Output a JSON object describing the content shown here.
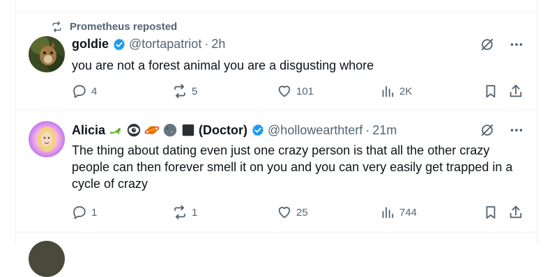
{
  "reposter": {
    "text": "Prometheus reposted",
    "icon": "repost-icon"
  },
  "tweets": [
    {
      "name": "goldie",
      "handle": "@tortapatriot",
      "separator": "·",
      "time": "2h",
      "text": "you are not a forest animal you are a disgusting whore",
      "replies": "4",
      "reposts": "5",
      "likes": "101",
      "views": "2K"
    },
    {
      "name": "Alicia",
      "name_suffix": "(Doctor)",
      "name_emojis": [
        "lizard-emoji",
        "eye-emoji",
        "planet-emoji",
        "moon-emoji",
        "black-square-emoji"
      ],
      "handle": "@hollowearthterf",
      "separator": "·",
      "time": "21m",
      "text": "The thing about dating even just one crazy person is that all the other crazy people can then forever smell it on you and you can very easily get trapped in a cycle of crazy",
      "replies": "1",
      "reposts": "1",
      "likes": "25",
      "views": "744"
    }
  ],
  "colors": {
    "verified": "#1d9bf0",
    "muted": "#536471",
    "text": "#0f1419",
    "border": "#eff3f4"
  }
}
